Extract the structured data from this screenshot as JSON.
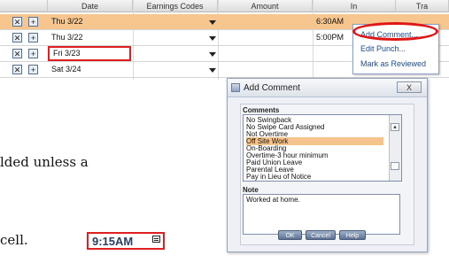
{
  "grid": {
    "headers": [
      "Date",
      "Earnings Codes",
      "Amount",
      "In",
      "Tra"
    ],
    "rows": [
      {
        "date": "Thu 3/22",
        "in": "6:30AM"
      },
      {
        "date": "Thu 3/22",
        "in": "5:00PM"
      },
      {
        "date": "Fri 3/23",
        "in": ""
      },
      {
        "date": "Sat 3/24",
        "in": ""
      }
    ]
  },
  "context_menu": {
    "items": [
      "Add Comment...",
      "Edit Punch...",
      "Mark as Reviewed"
    ]
  },
  "dialog": {
    "title": "Add Comment",
    "close": "X",
    "comments_label": "Comments",
    "comments": [
      "No Swingback",
      "No Swipe Card Assigned",
      "Not Overtime",
      "Off Site Work",
      "On-Boarding",
      "Overtime-3 hour minimum",
      "Paid Union Leave",
      "Parental Leave",
      "Pay in Lieu of Notice"
    ],
    "selected_comment": "Off Site Work",
    "note_label": "Note",
    "note_value": "Worked at home.",
    "buttons": [
      "OK",
      "Cancel",
      "Help"
    ]
  },
  "body_text": {
    "line1": "lded unless a",
    "line2": "cell."
  },
  "time_badge": {
    "value": "9:15AM"
  },
  "colors": {
    "selected_row": "#f7c68e",
    "highlight_red": "#e02020",
    "menu_text": "#1e4a8c"
  }
}
